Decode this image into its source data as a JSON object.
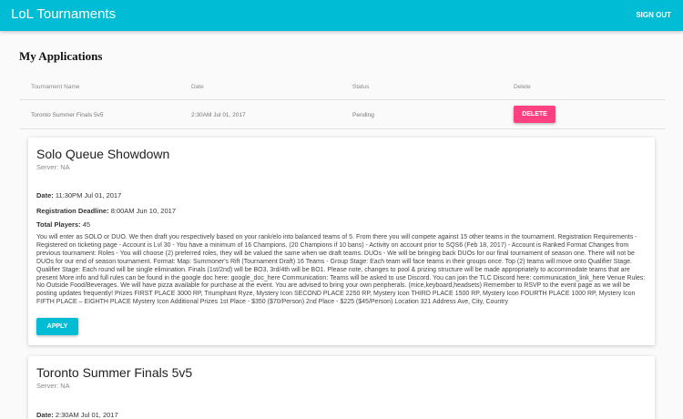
{
  "appbar": {
    "title": "LoL Tournaments",
    "signout": "SIGN OUT"
  },
  "page_title": "My Applications",
  "table": {
    "headers": [
      "Tournament Name",
      "Date",
      "Status",
      "Delete"
    ],
    "rows": [
      {
        "name": "Toronto Summer Finals 5v5",
        "date": "2:30AM Jul 01, 2017",
        "status": "Pending",
        "delete_label": "DELETE"
      }
    ]
  },
  "cards": [
    {
      "title": "Solo Queue Showdown",
      "server": "Server: NA",
      "date_label": "Date:",
      "date_value": " 11:30PM Jul 01, 2017",
      "deadline_label": "Registration Deadline:",
      "deadline_value": " 8:00AM Jun 10, 2017",
      "players_label": "Total Players:",
      "players_value": " 45",
      "description": "You will enter as SOLO or DUO. We then draft you respectively based on your rank/elo into balanced teams of 5. From there you will compete against 15 other teams in the tournament. Registration Requirements - Registered on ticketing page - Account is Lvl 30 - You have a minimum of 16 Champions. (20 Champions if 10 bans) - Activity on account prior to SQS6 (Feb 18, 2017) - Account is Ranked Format Changes from previous tournament: Roles - You will choose (2) preferred roles, they will be valued the same when we draft teams. DUOs - We will be bringing back DUOs for our final tournament of season one. There will not be DUOs for our end of season tournament. Format: Map: Summoner's Rift (Tournament Draft) 16 Teams - Group Stage: Each team will face teams in their groups once. Top (2) teams will move onto Qualifier Stage. Qualifier Stage: Each round will be single elimination. Finals (1st/2nd) will be BO3, 3rd/4th will be BO1. Please note, changes to pool & prizing structure will be made appropriately to accommodate teams that are present More info and full rules can be found in the google doc here: google_doc_here Communication: Teams will be asked to use Discord. You can join the TLC Discord here: communication_link_here Venue Rules: No Outside Food/Beverages. We will have pizza available for purchase at the event. You are advised to bring your own peripherals. (mice,keyboard,headsets) Remember to RSVP to the event page as we will be posting updates frequently! Prizes FIRST PLACE 3000 RP, Triumphant Ryze, Mystery Icon SECOND PLACE 2250 RP, Mystery Icon THIRD PLACE 1500 RP, Mystery Icon FOURTH PLACE 1000 RP, Mystery Icon FIFTH PLACE – EIGHTH PLACE Mystery Icon Additional Prizes 1st Place - $350 ($70/Person) 2nd Place - $225 ($45/Person) Location 321 Address Ave, City, Country",
      "apply_label": "APPLY"
    },
    {
      "title": "Toronto Summer Finals 5v5",
      "server": "Server: NA",
      "date_label": "Date:",
      "date_value": " 2:30AM Jul 01, 2017"
    }
  ]
}
